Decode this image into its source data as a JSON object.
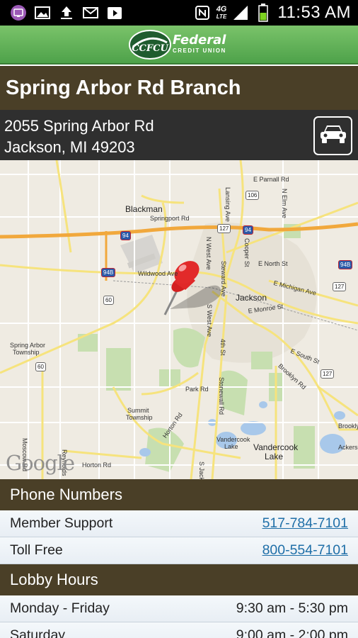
{
  "status_bar": {
    "time": "11:53 AM",
    "network": "4G",
    "network_sub": "LTE",
    "icons": [
      "app-icon",
      "image-icon",
      "upload-icon",
      "gmail-icon",
      "youtube-icon",
      "nfc-icon",
      "signal-icon",
      "battery-icon"
    ]
  },
  "app": {
    "logo_text": "Federal",
    "logo_subtext": "CREDIT UNION",
    "logo_mark": "CCFCU",
    "brand_color": "#4ea24a"
  },
  "branch": {
    "title": "Spring Arbor Rd Branch",
    "address_line1": "2055 Spring Arbor Rd",
    "address_line2": "Jackson, MI 49203",
    "directions_icon": "car-icon"
  },
  "map": {
    "provider": "Google",
    "labels": {
      "blackman": "Blackman",
      "springport": "Springport Rd",
      "wildwood": "Wildwood Ave",
      "jackson": "Jackson",
      "spring_arbor": "Spring Arbor",
      "township": "Township",
      "summit": "Summit",
      "summit_twp": "Township",
      "park": "Park Rd",
      "horton": "Horton Rd",
      "horton2": "Horton Rd",
      "vandercook": "Vandercook",
      "lake": "Lake",
      "vandercook_lake": "Vandercook",
      "vlake": "Lake",
      "e_parnall": "E Parnall Rd",
      "e_north": "E North St",
      "e_michigan": "E Michigan Ave",
      "e_monroe": "E Monroe St",
      "e_south": "E South St",
      "brooklyn": "Brooklyn Rd",
      "brookly": "Brookly",
      "ackerson": "Ackerson",
      "lansing": "Lansing Ave",
      "cooper": "Cooper St",
      "n_elm": "N Elm Ave",
      "n_west": "N West Ave",
      "steward": "Steward Ave",
      "s_west": "S West Ave",
      "fourth": "4th St",
      "stonewall": "Stonewall Rd",
      "moscow": "Moscow Rd",
      "reynolds": "Reynolds",
      "s_jack": "S Jack"
    },
    "shields": [
      "94",
      "127",
      "106",
      "94",
      "94B",
      "60",
      "94B",
      "127",
      "60",
      "127",
      "127",
      "60"
    ]
  },
  "phone": {
    "header": "Phone Numbers",
    "rows": [
      {
        "label": "Member Support",
        "value": "517-784-7101"
      },
      {
        "label": "Toll Free",
        "value": "800-554-7101"
      }
    ]
  },
  "hours": {
    "header": "Lobby Hours",
    "rows": [
      {
        "label": "Monday - Friday",
        "value": "9:30 am - 5:30 pm"
      },
      {
        "label": "Saturday",
        "value": "9:00 am - 2:00 pm"
      }
    ]
  }
}
